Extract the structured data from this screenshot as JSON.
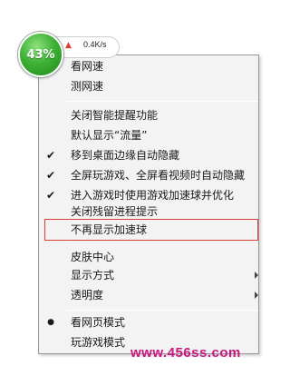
{
  "ball": {
    "percent_label": "43%",
    "color": "#3fb136"
  },
  "speed": {
    "arrow_icon": "upload-arrow-icon",
    "value": "0.4K/s"
  },
  "menu": {
    "items": [
      {
        "label": "看网速",
        "check": false
      },
      {
        "label": "测网速",
        "check": false
      },
      {
        "label": "关闭智能提醒功能",
        "check": false
      },
      {
        "label": "默认显示“流量”",
        "check": false
      },
      {
        "label": "移到桌面边缘自动隐藏",
        "check": true
      },
      {
        "label": "全屏玩游戏、全屏看视频时自动隐藏",
        "check": true
      },
      {
        "label": "进入游戏时使用游戏加速球并优化",
        "check": true
      },
      {
        "label": "关闭残留进程提示",
        "check": false
      },
      {
        "label": "不再显示加速球",
        "check": false,
        "highlighted": true
      },
      {
        "label": "皮肤中心",
        "check": false
      },
      {
        "label": "显示方式",
        "check": false,
        "submenu": true
      },
      {
        "label": "透明度",
        "check": false,
        "submenu": true
      },
      {
        "label": "看网页模式",
        "bullet": true
      },
      {
        "label": "玩游戏模式",
        "bullet": false
      }
    ],
    "check_glyph": "✔",
    "bullet_glyph": "●",
    "highlight_color": "#d9403a"
  },
  "watermark": "www.456ss.com"
}
